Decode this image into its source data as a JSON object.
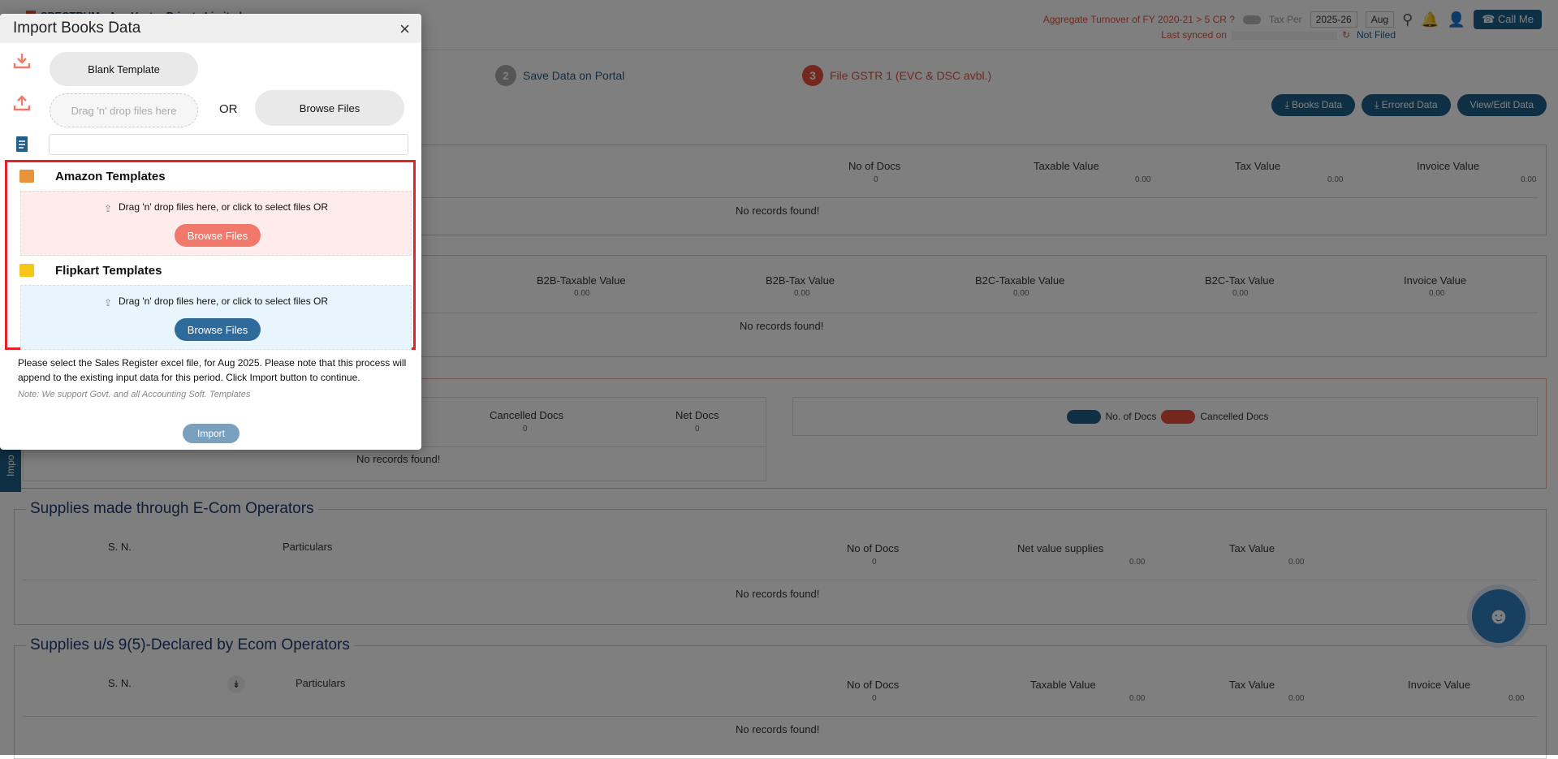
{
  "background": {
    "company_name": "SPECTRUM - Ace Vector Private Limited",
    "turnover_text": "Aggregate Turnover of FY 2020-21 > 5 CR ?",
    "tax_period_label": "Tax Per",
    "fy_value": "2025-26",
    "month_value": "Aug",
    "last_synced_label": "Last synced on",
    "not_filed_label": "Not Filed",
    "call_me_label": "Call Me",
    "steps": [
      {
        "num": "2",
        "label": "Save Data on Portal"
      },
      {
        "num": "3",
        "label": "File GSTR 1 (EVC & DSC avbl.)"
      }
    ],
    "action_buttons": [
      "Books Data",
      "Errored Data",
      "View/Edit Data"
    ],
    "section1": {
      "headers": [
        "No of Docs",
        "Taxable Value",
        "Tax Value",
        "Invoice Value"
      ],
      "subs": [
        "0",
        "0.00",
        "0.00",
        "0.00"
      ],
      "empty": "No records found!"
    },
    "section2": {
      "headers": [
        "B2B-Taxable Value",
        "B2B-Tax Value",
        "B2C-Taxable Value",
        "B2C-Tax Value",
        "Invoice Value"
      ],
      "subs": [
        "0.00",
        "0.00",
        "0.00",
        "0.00",
        "0.00"
      ],
      "empty": "No records found!"
    },
    "section3": {
      "headers": [
        "Cancelled Docs",
        "Net Docs"
      ],
      "subs": [
        "0",
        "0"
      ],
      "empty": "No records found!",
      "legend": [
        "No. of Docs",
        "Cancelled Docs"
      ]
    },
    "section4": {
      "title": "Supplies made through E-Com Operators",
      "headers": [
        "S. N.",
        "Particulars",
        "No of Docs",
        "Net value supplies",
        "Tax Value"
      ],
      "subs": [
        "0",
        "0.00",
        "0.00"
      ],
      "empty": "No records found!"
    },
    "section5": {
      "title": "Supplies u/s 9(5)-Declared by Ecom Operators",
      "headers": [
        "S. N.",
        "Particulars",
        "No of Docs",
        "Taxable Value",
        "Tax Value",
        "Invoice Value"
      ],
      "subs": [
        "0",
        "0.00",
        "0.00",
        "0.00"
      ],
      "empty": "No records found!"
    },
    "side_tab": "Impo"
  },
  "modal": {
    "title": "Import Books Data",
    "close": "×",
    "blank_template_label": "Blank Template",
    "drop_placeholder": "Drag 'n' drop files here",
    "or_label": "OR",
    "browse_files_label": "Browse Files",
    "amazon": {
      "title": "Amazon Templates",
      "drop_text": "Drag 'n' drop files here, or click to select files OR",
      "button": "Browse Files",
      "zone_color": "#fdeceb",
      "button_color": "#f0796c"
    },
    "flipkart": {
      "title": "Flipkart Templates",
      "drop_text": "Drag 'n' drop files here, or click to select files OR",
      "button": "Browse Files",
      "zone_color": "#e9f5fc",
      "button_color": "#2f6b9a"
    },
    "help_text": "Please select the Sales Register excel file, for Aug 2025. Please note that this process will append to the existing input data for this period. Click Import button to continue.",
    "note": "Note: We support Govt. and all Accounting Soft. Templates",
    "import_label": "Import"
  }
}
